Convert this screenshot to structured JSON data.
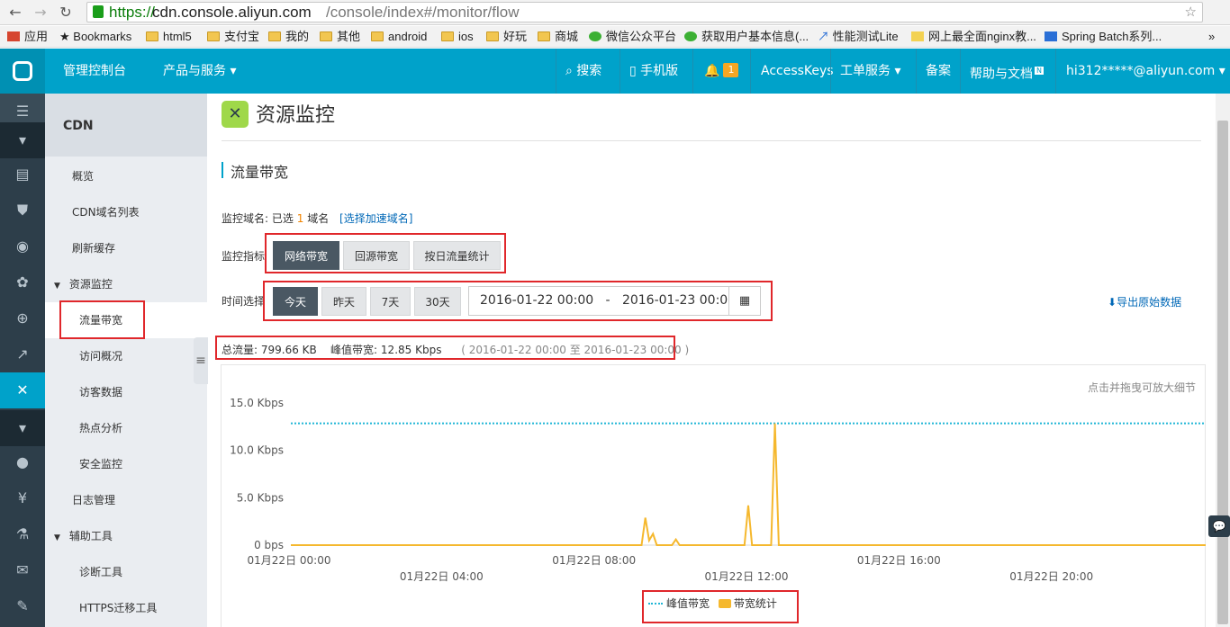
{
  "browser": {
    "url_scheme": "https://",
    "url_host": "cdn.console.aliyun.com",
    "url_path": "/console/index#/monitor/flow",
    "bookmarks": [
      "应用",
      "Bookmarks",
      "html5",
      "支付宝",
      "我的",
      "其他",
      "android",
      "ios",
      "好玩",
      "商城",
      "微信公众平台",
      "获取用户基本信息(...",
      "性能测试Lite",
      "网上最全面nginx教...",
      "Spring Batch系列..."
    ]
  },
  "topbar": {
    "console": "管理控制台",
    "products": "产品与服务",
    "search": "搜索",
    "mobile": "手机版",
    "bell_count": "1",
    "accesskeys": "AccessKeys",
    "tickets": "工单服务",
    "beian": "备案",
    "help": "帮助与文档",
    "help_badge": "N",
    "user": "hi312*****@aliyun.com"
  },
  "sidenav": {
    "title": "CDN",
    "items": [
      "概览",
      "CDN域名列表",
      "刷新缓存",
      "资源监控",
      "流量带宽",
      "访问概况",
      "访客数据",
      "热点分析",
      "安全监控",
      "日志管理",
      "辅助工具",
      "诊断工具",
      "HTTPS迁移工具"
    ]
  },
  "page": {
    "title": "资源监控",
    "section": "流量带宽",
    "domain_label": "监控域名:",
    "domain_selected_prefix": "已选",
    "domain_count": "1",
    "domain_unit": "域名",
    "domain_link": "[选择加速域名]",
    "metric_label": "监控指标",
    "metric_buttons": [
      "网络带宽",
      "回源带宽",
      "按日流量统计"
    ],
    "time_label": "时间选择",
    "time_buttons": [
      "今天",
      "昨天",
      "7天",
      "30天"
    ],
    "date_start": "2016-01-22 00:00",
    "date_sep": "-",
    "date_end": "2016-01-23 00:00",
    "export": "导出原始数据",
    "summary_total_label": "总流量:",
    "summary_total": "799.66 KB",
    "summary_peak_label": "峰值带宽:",
    "summary_peak": "12.85 Kbps",
    "summary_range": "( 2016-01-22 00:00 至 2016-01-23 00:00 )",
    "chart_hint": "点击并拖曳可放大细节"
  },
  "chart_data": {
    "type": "line",
    "y_ticks": [
      "0 bps",
      "5.0 Kbps",
      "10.0 Kbps",
      "15.0 Kbps"
    ],
    "x_ticks": [
      "01月22日 00:00",
      "01月22日 04:00",
      "01月22日 08:00",
      "01月22日 12:00",
      "01月22日 16:00",
      "01月22日 20:00"
    ],
    "ylim": [
      0,
      15
    ],
    "xlim_hours": [
      0,
      24
    ],
    "series": [
      {
        "name": "峰值带宽",
        "color": "#22b6d6",
        "style": "dotted",
        "x": [
          0,
          24
        ],
        "y": [
          12.85,
          12.85
        ]
      },
      {
        "name": "带宽统计",
        "color": "#f5b82e",
        "style": "solid",
        "x": [
          0,
          9.2,
          9.3,
          9.4,
          9.5,
          9.6,
          9.7,
          9.8,
          10.0,
          10.1,
          10.2,
          11.9,
          12.0,
          12.1,
          12.6,
          12.7,
          12.8,
          24
        ],
        "y": [
          0,
          0,
          2.9,
          0.5,
          1.2,
          0,
          0,
          0,
          0,
          0.6,
          0,
          0,
          4.2,
          0,
          0,
          12.85,
          0,
          0
        ]
      }
    ]
  }
}
